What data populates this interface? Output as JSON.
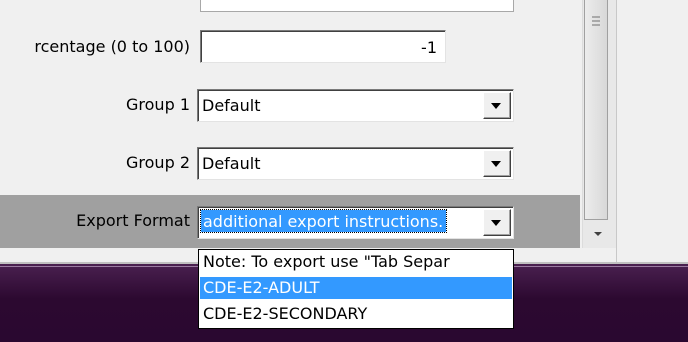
{
  "form": {
    "percentage_label": "rcentage (0 to 100)",
    "percentage_value": "-1",
    "group1_label": "Group 1",
    "group1_value": "Default",
    "group2_label": "Group 2",
    "group2_value": "Default",
    "export_label": "Export Format",
    "export_value": "additional export instructions."
  },
  "dropdown": {
    "items": [
      "Note:  To export use \"Tab Separ",
      "CDE-E2-ADULT",
      "CDE-E2-SECONDARY"
    ],
    "selected_index": 1
  },
  "icons": {
    "combo_arrow": "chevron-down-icon",
    "scroll_grip": "grip-icon",
    "scroll_down": "arrow-down-icon"
  },
  "colors": {
    "selection": "#3399ff",
    "export_band": "#a0a0a0",
    "bottom_band": "#2c0930"
  }
}
